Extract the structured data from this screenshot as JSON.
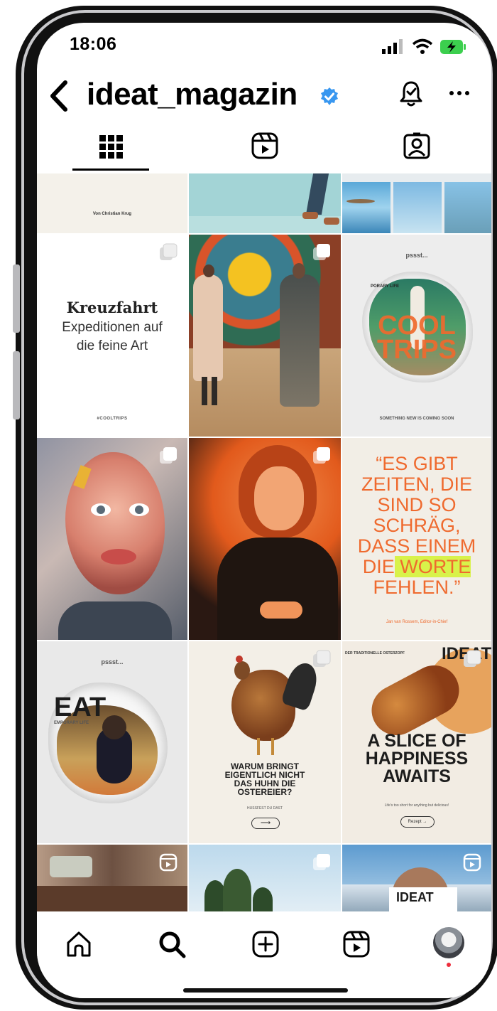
{
  "status_bar": {
    "time": "18:06"
  },
  "header": {
    "username": "ideat_magazin"
  },
  "posts": {
    "row0_left_caption": "Von Christian Krug",
    "kreuzfahrt": {
      "title": "Kreuzfahrt",
      "subtitle_line1": "Expeditionen auf",
      "subtitle_line2": "die feine Art",
      "hashtag": "#COOLTRIPS"
    },
    "pssst_cool": {
      "kicker": "pssst...",
      "label": "PORARY LIFE",
      "headline_1": "COOL",
      "headline_2": "TRIPS",
      "footer": "SOMETHING NEW IS COMING SOON"
    },
    "quote": {
      "line1": "“ES GIBT",
      "line2": "ZEITEN, DIE",
      "line3": "SIND SO",
      "line4": "SCHRÄG,",
      "line5": "DASS EINEM",
      "line6a": "DIE",
      "line6b": " WORTE",
      "line7": "FEHLEN.”",
      "credit": "Jan van Rossem, Editor-in-Chief"
    },
    "pssst_eat": {
      "kicker": "pssst...",
      "logo": "EAT",
      "label": "EMPORARY LIFE"
    },
    "chicken": {
      "line1": "WARUM BRINGT",
      "line2": "EIGENTLICH NICHT",
      "line3": "DAS HUHN DIE",
      "line4": "OSTEREIER?",
      "small": "HUSSFEST DU DAST",
      "arrow": "⟶"
    },
    "bread": {
      "kicker": "DER TRADITIONELLE OSTERZOPF",
      "logo": "IDEAT",
      "line1": "A SLICE OF",
      "line2": "HAPPINESS",
      "line3": "AWAITS",
      "small": "Life's too short for anything but delicious!",
      "button": "Rezept →"
    },
    "ideat_sign": "IDEAT"
  },
  "colors": {
    "orange": "#ef6a2e",
    "verified_blue": "#3897f0",
    "highlight": "#d8f24a",
    "dark_orange": "#e25a1c"
  }
}
